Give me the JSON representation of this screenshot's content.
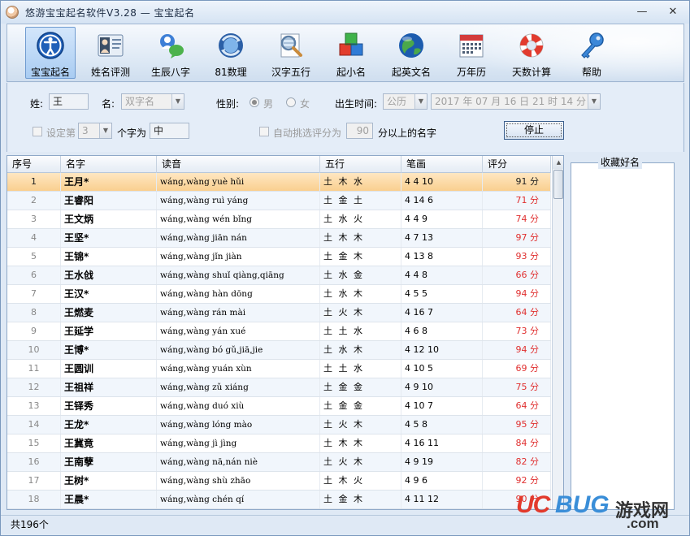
{
  "window": {
    "title": "悠游宝宝起名软件V3.28  —  宝宝起名",
    "minimize": "—",
    "close": "✕"
  },
  "toolbar": {
    "items": [
      {
        "label": "宝宝起名",
        "icon": "baby-person-icon",
        "active": true
      },
      {
        "label": "姓名评测",
        "icon": "person-card-icon",
        "active": false
      },
      {
        "label": "生辰八字",
        "icon": "chat-person-icon",
        "active": false
      },
      {
        "label": "81数理",
        "icon": "sync-globe-icon",
        "active": false
      },
      {
        "label": "汉字五行",
        "icon": "magnifier-document-icon",
        "active": false
      },
      {
        "label": "起小名",
        "icon": "color-blocks-icon",
        "active": false
      },
      {
        "label": "起英文名",
        "icon": "globe-icon",
        "active": false
      },
      {
        "label": "万年历",
        "icon": "calendar-icon",
        "active": false
      },
      {
        "label": "天数计算",
        "icon": "lifebuoy-icon",
        "active": false
      },
      {
        "label": "帮助",
        "icon": "key-icon",
        "active": false
      }
    ]
  },
  "options": {
    "surname_label": "姓:",
    "surname_value": "王",
    "name_label": "名:",
    "name_type": "双字名",
    "gender_label": "性别:",
    "gender_male": "男",
    "gender_female": "女",
    "birth_label": "出生时间:",
    "calendar_type": "公历",
    "birth_datetime": "2017 年 07 月 16 日   21 时 14 分",
    "fix_label": "设定第",
    "fix_position": "3",
    "fix_char_label": "个字为",
    "fix_char_value": "中",
    "auto_label": "自动挑选评分为",
    "auto_score": "90",
    "auto_suffix": "分以上的名字",
    "stop_button": "停止"
  },
  "table": {
    "headers": [
      "序号",
      "名字",
      "读音",
      "五行",
      "笔画",
      "评分"
    ],
    "rows": [
      {
        "no": "1",
        "name": "王月*",
        "pinyin": "wáng,wàng yuè hǔi",
        "wuxing": "土 木 水",
        "strokes": "4 4 10",
        "score": "91 分",
        "selected": true
      },
      {
        "no": "2",
        "name": "王睿阳",
        "pinyin": "wáng,wàng ruì yáng",
        "wuxing": "土 金 土",
        "strokes": "4 14 6",
        "score": "71 分"
      },
      {
        "no": "3",
        "name": "王文炳",
        "pinyin": "wáng,wàng wén bǐng",
        "wuxing": "土 水 火",
        "strokes": "4 4 9",
        "score": "74 分"
      },
      {
        "no": "4",
        "name": "王坚*",
        "pinyin": "wáng,wàng jiān nán",
        "wuxing": "土 木 木",
        "strokes": "4 7 13",
        "score": "97 分"
      },
      {
        "no": "5",
        "name": "王锦*",
        "pinyin": "wáng,wàng jǐn jiàn",
        "wuxing": "土 金 木",
        "strokes": "4 13 8",
        "score": "93 分"
      },
      {
        "no": "6",
        "name": "王水戗",
        "pinyin": "wáng,wàng shuǐ qiàng,qiāng",
        "wuxing": "土 水 金",
        "strokes": "4 4 8",
        "score": "66 分"
      },
      {
        "no": "7",
        "name": "王汉*",
        "pinyin": "wáng,wàng hàn dōng",
        "wuxing": "土 水 木",
        "strokes": "4 5 5",
        "score": "94 分"
      },
      {
        "no": "8",
        "name": "王燃麦",
        "pinyin": "wáng,wàng rán mài",
        "wuxing": "土 火 木",
        "strokes": "4 16 7",
        "score": "64 分"
      },
      {
        "no": "9",
        "name": "王延学",
        "pinyin": "wáng,wàng yán xué",
        "wuxing": "土 土 水",
        "strokes": "4 6 8",
        "score": "73 分"
      },
      {
        "no": "10",
        "name": "王博*",
        "pinyin": "wáng,wàng bó gǔ,jiā,jie",
        "wuxing": "土 水 木",
        "strokes": "4 12 10",
        "score": "94 分"
      },
      {
        "no": "11",
        "name": "王圆训",
        "pinyin": "wáng,wàng yuán xùn",
        "wuxing": "土 土 水",
        "strokes": "4 10 5",
        "score": "69 分"
      },
      {
        "no": "12",
        "name": "王祖祥",
        "pinyin": "wáng,wàng zǔ xiáng",
        "wuxing": "土 金 金",
        "strokes": "4 9 10",
        "score": "75 分"
      },
      {
        "no": "13",
        "name": "王铎秀",
        "pinyin": "wáng,wàng duó xiù",
        "wuxing": "土 金 金",
        "strokes": "4 10 7",
        "score": "64 分"
      },
      {
        "no": "14",
        "name": "王龙*",
        "pinyin": "wáng,wàng lóng mào",
        "wuxing": "土 火 木",
        "strokes": "4 5 8",
        "score": "95 分"
      },
      {
        "no": "15",
        "name": "王冀竟",
        "pinyin": "wáng,wàng jì jìng",
        "wuxing": "土 木 木",
        "strokes": "4 16 11",
        "score": "84 分"
      },
      {
        "no": "16",
        "name": "王南孽",
        "pinyin": "wáng,wàng nā,nán niè",
        "wuxing": "土 火 木",
        "strokes": "4 9 19",
        "score": "82 分"
      },
      {
        "no": "17",
        "name": "王树*",
        "pinyin": "wáng,wàng shù zhāo",
        "wuxing": "土 木 火",
        "strokes": "4 9 6",
        "score": "92 分"
      },
      {
        "no": "18",
        "name": "王晨*",
        "pinyin": "wáng,wàng chén qí",
        "wuxing": "土 金 木",
        "strokes": "4 11 12",
        "score": "90 分"
      }
    ]
  },
  "favorites": {
    "title": "收藏好名"
  },
  "status": {
    "count_text": "共196个"
  },
  "watermark": {
    "uc": "UC",
    "bug": "BUG",
    "cn": "游戏网",
    "com": ".com"
  },
  "colors": {
    "selected_row": "#f9cf8f",
    "score_text": "#e03030",
    "toolbar_bg": "#dbe7f4",
    "window_bg": "#dfe9f5"
  }
}
